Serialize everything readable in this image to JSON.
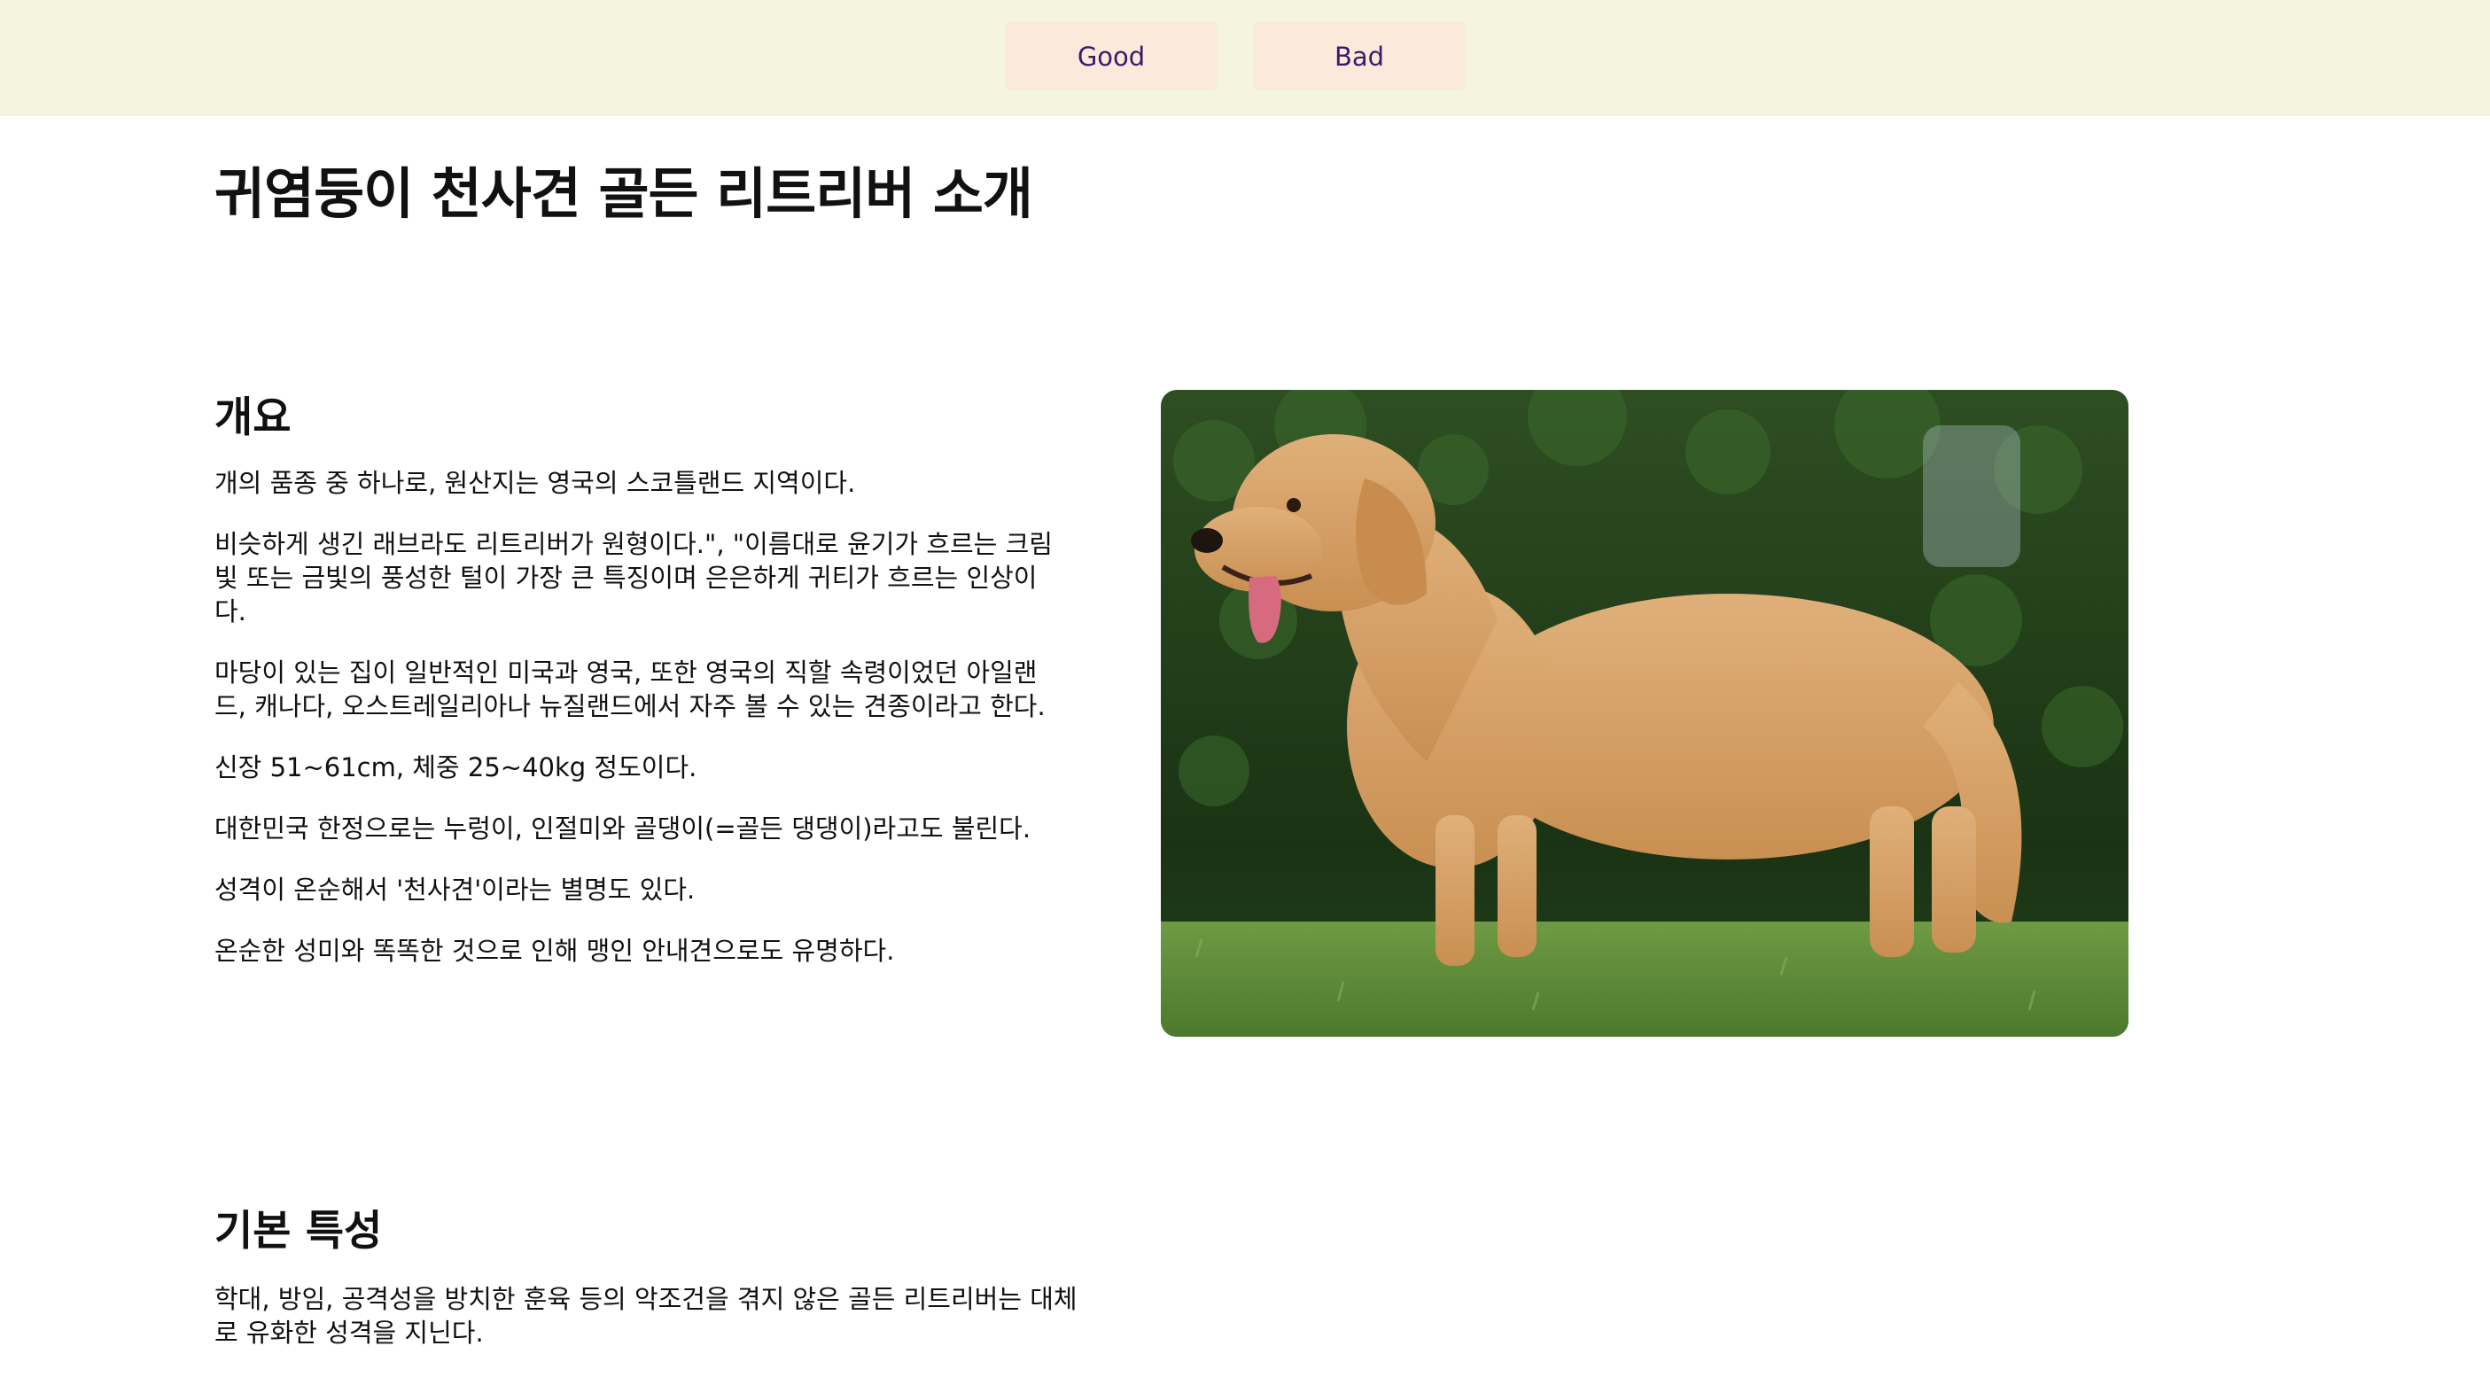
{
  "nav": {
    "good_label": "Good",
    "bad_label": "Bad"
  },
  "page": {
    "title": "귀염둥이 천사견 골든 리트리버 소개"
  },
  "overview": {
    "heading": "개요",
    "paragraphs": [
      "개의 품종 중 하나로, 원산지는 영국의 스코틀랜드 지역이다.",
      "비슷하게 생긴 래브라도 리트리버가 원형이다.\", \"이름대로 윤기가 흐르는 크림빛 또는 금빛의 풍성한 털이 가장 큰 특징이며 은은하게 귀티가 흐르는 인상이다.",
      "마당이 있는 집이 일반적인 미국과 영국, 또한 영국의 직할 속령이었던 아일랜드, 캐나다, 오스트레일리아나 뉴질랜드에서 자주 볼 수 있는 견종이라고 한다.",
      "신장 51~61cm, 체중 25~40kg 정도이다.",
      "대한민국 한정으로는 누렁이, 인절미와 골댕이(=골든 댕댕이)라고도 불린다.",
      "성격이 온순해서 '천사견'이라는 별명도 있다.",
      "온순한 성미와 똑똑한 것으로 인해 맹인 안내견으로도 유명하다."
    ],
    "image": {
      "icon": "golden-retriever-photo",
      "colors": {
        "foliage": "#1f3d1a",
        "grass": "#5c8a3a",
        "fur": "#d9a66b"
      }
    }
  },
  "traits": {
    "heading": "기본 특성",
    "paragraphs": [
      "학대, 방임, 공격성을 방치한 훈육 등의 악조건을 겪지 않은 골든 리트리버는 대체로 유화한 성격을 지닌다."
    ]
  },
  "colors": {
    "topbar_bg": "#f5f4dc",
    "button_bg": "#faeadb",
    "button_text": "#3b1a66"
  }
}
